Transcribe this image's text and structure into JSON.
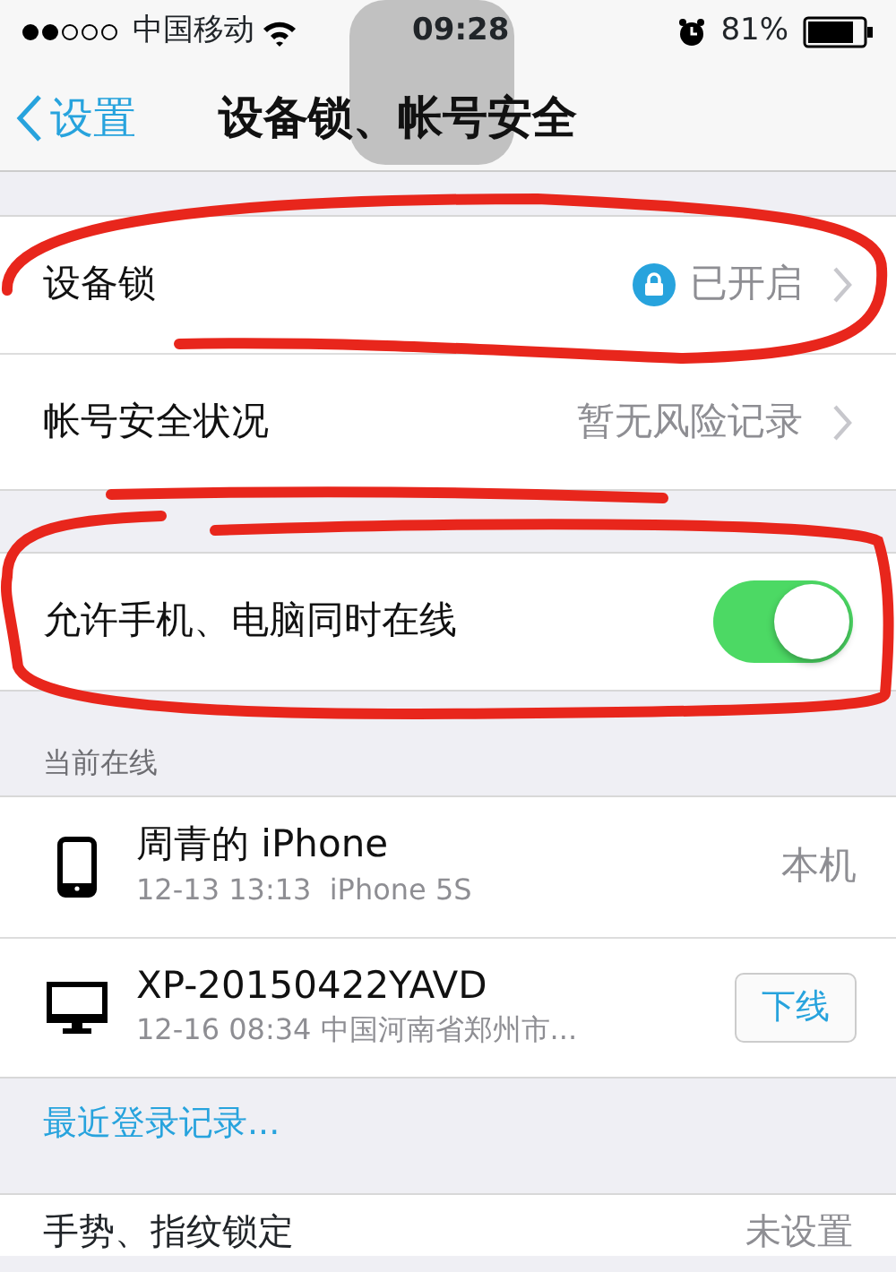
{
  "status_bar": {
    "carrier": "中国移动",
    "time": "09:28",
    "battery": "81%"
  },
  "nav": {
    "back": "设置",
    "title": "设备锁、帐号安全"
  },
  "settings": [
    {
      "kind": "detail",
      "label": "设备锁",
      "value": "已开启",
      "locked": true
    },
    {
      "kind": "detail",
      "label": "帐号安全状况",
      "value": "暂无风险记录",
      "locked": false
    },
    {
      "kind": "switch",
      "label": "允许手机、电脑同时在线",
      "on": true
    }
  ],
  "online": {
    "header": "当前在线",
    "devices": [
      {
        "kind": "phone",
        "name": "周青的 iPhone",
        "detail": "12-13 13:13  iPhone 5S",
        "action_is_button": false,
        "action": "本机"
      },
      {
        "kind": "computer",
        "name": "XP-20150422YAVD",
        "detail": "12-16 08:34 中国河南省郑州市...",
        "action_is_button": true,
        "action": "下线"
      }
    ]
  },
  "recent_link": "最近登录记录...",
  "bottom_row": {
    "label": "手势、指纹锁定",
    "value": "未设置"
  }
}
